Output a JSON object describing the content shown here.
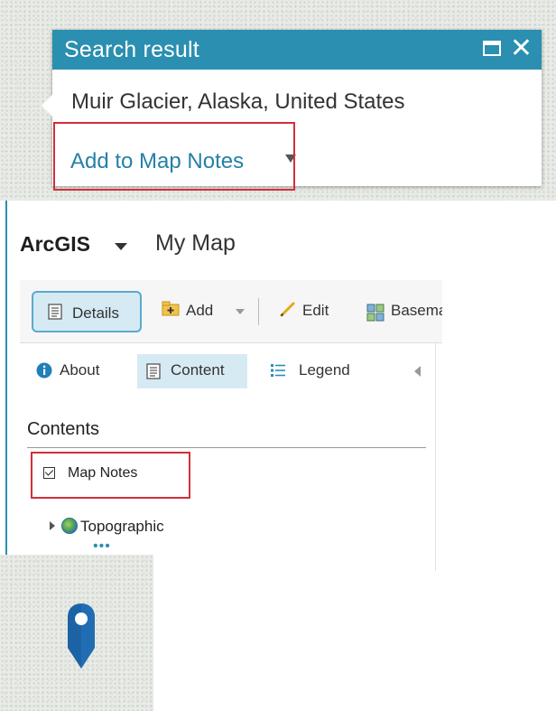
{
  "popup": {
    "title": "Search result",
    "place": "Muir Glacier, Alaska, United States",
    "action_label": "Add to Map Notes"
  },
  "header": {
    "brand": "ArcGIS",
    "map_title": "My Map"
  },
  "toolbar": {
    "details_label": "Details",
    "add_label": "Add",
    "edit_label": "Edit",
    "basemap_label": "Basemap"
  },
  "tabs": [
    {
      "label": "About",
      "icon": "info-icon",
      "active": false
    },
    {
      "label": "Content",
      "icon": "content-doc-icon",
      "active": true
    },
    {
      "label": "Legend",
      "icon": "legend-list-icon",
      "active": false
    }
  ],
  "contents": {
    "heading": "Contents",
    "layers": [
      {
        "label": "Map Notes",
        "checked": true
      },
      {
        "label": "Topographic",
        "icon": "globe-icon"
      }
    ]
  },
  "colors": {
    "accent": "#2a8fb0",
    "highlight": "#d32f3a",
    "active_tab": "#d6eaf4",
    "pin": "#1c63a5"
  },
  "icons": {
    "maximize": "maximize-icon",
    "close": "close-icon",
    "pin": "map-pin-icon"
  }
}
